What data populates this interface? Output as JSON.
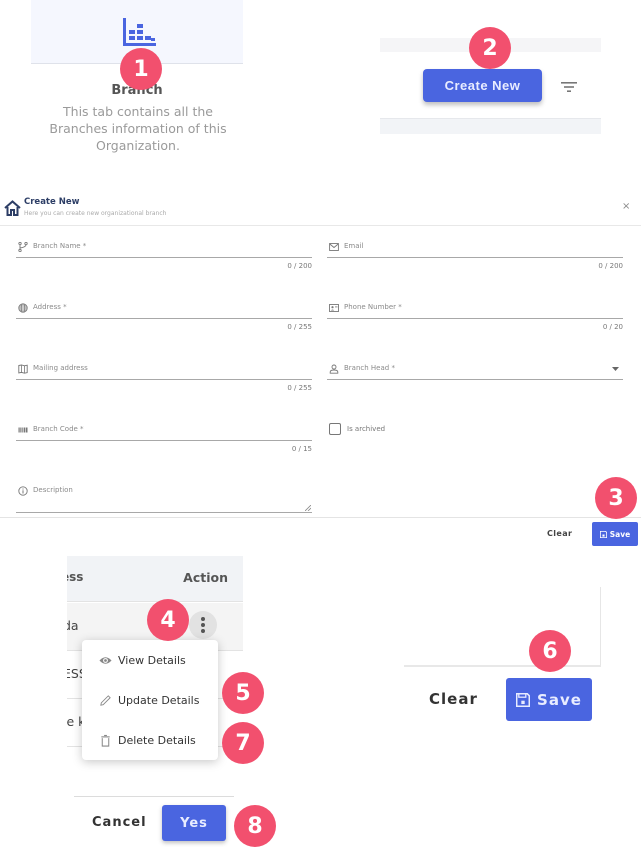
{
  "colors": {
    "accent": "#4a65e0",
    "badge": "#f2506e"
  },
  "badges": [
    "1",
    "2",
    "3",
    "4",
    "5",
    "6",
    "7",
    "8"
  ],
  "branch_tab": {
    "icon": "bar-chart-icon",
    "title": "Branch",
    "description": "This tab contains all the Branches information of this Organization."
  },
  "toolbar": {
    "create_label": "Create New",
    "filter_icon": "filter-icon"
  },
  "form": {
    "title": "Create New",
    "subtitle": "Here you can create new organizational branch",
    "close_icon": "×",
    "fields": {
      "branch_name": {
        "label": "Branch Name *",
        "count": "0 / 200",
        "icon": "branch-icon"
      },
      "email": {
        "label": "Email",
        "count": "0 / 200",
        "icon": "mail-icon"
      },
      "address": {
        "label": "Address *",
        "count": "0 / 255",
        "icon": "globe-icon"
      },
      "phone": {
        "label": "Phone Number *",
        "count": "0 / 20",
        "icon": "contact-card-icon"
      },
      "mailing_address": {
        "label": "Mailing address",
        "count": "0 / 255",
        "icon": "map-icon"
      },
      "branch_head": {
        "label": "Branch Head *",
        "icon": "person-icon"
      },
      "branch_code": {
        "label": "Branch Code *",
        "count": "0 / 15",
        "icon": "barcode-icon"
      },
      "is_archived": {
        "label": "Is archived",
        "checked": false
      },
      "description": {
        "label": "Description",
        "icon": "info-icon"
      }
    },
    "clear_label": "Clear",
    "save_label": "Save"
  },
  "table": {
    "headers": [
      "ess",
      "Action"
    ],
    "rows": [
      {
        "address": "da"
      },
      {
        "address": "ESS"
      },
      {
        "address": "ie k"
      }
    ]
  },
  "action_menu": {
    "items": [
      {
        "label": "View Details",
        "icon": "eye-icon"
      },
      {
        "label": "Update Details",
        "icon": "pencil-icon"
      },
      {
        "label": "Delete Details",
        "icon": "trash-icon"
      }
    ]
  },
  "update_form_footer": {
    "clear_label": "Clear",
    "save_label": "Save"
  },
  "confirm_dialog": {
    "cancel_label": "Cancel",
    "yes_label": "Yes"
  }
}
